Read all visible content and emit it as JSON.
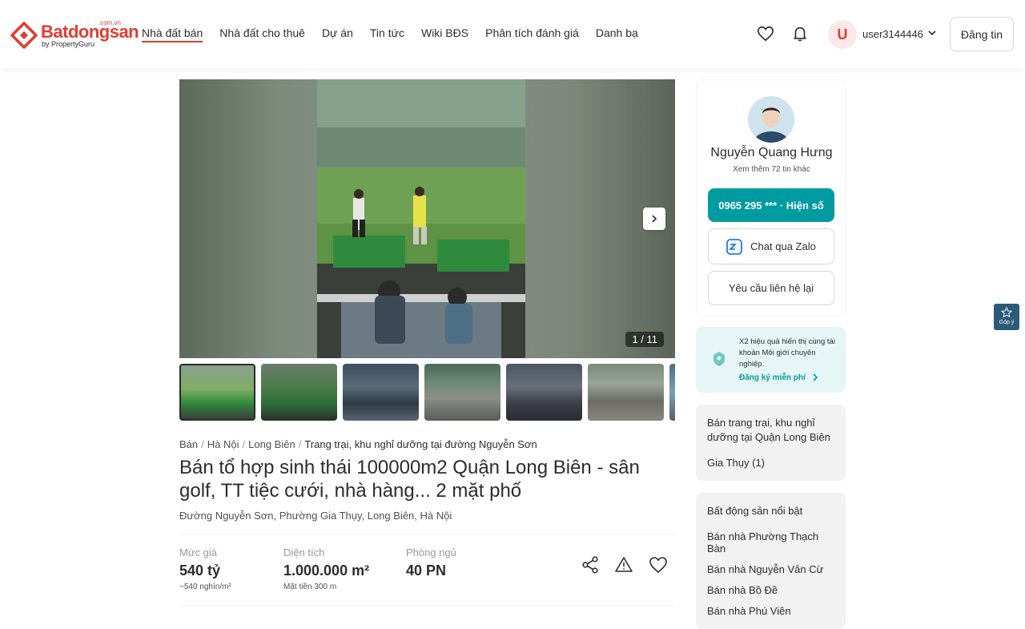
{
  "header": {
    "logo_text": "Batdongsan",
    "logo_comvn": ".com.vn",
    "logo_sub": "by PropertyGuru",
    "nav": [
      "Nhà đất bán",
      "Nhà đất cho thuê",
      "Dự án",
      "Tin tức",
      "Wiki BĐS",
      "Phân tích đánh giá",
      "Danh bạ"
    ],
    "avatar_letter": "U",
    "username": "user3144446",
    "post_label": "Đăng tin"
  },
  "gallery": {
    "counter": "1 / 11",
    "thumb_count": 7
  },
  "listing": {
    "breadcrumb": [
      "Bán",
      "Hà Nội",
      "Long Biên",
      "Trang trại, khu nghỉ dưỡng tại đường Nguyễn Sơn"
    ],
    "title": "Bán tổ hợp sinh thái 100000m2 Quận Long Biên - sân golf, TT tiệc cưới, nhà hàng... 2 mặt phố",
    "address": "Đường Nguyễn Sơn, Phường Gia Thụy, Long Biên, Hà Nội",
    "price_label": "Mức giá",
    "price_value": "540 tỷ",
    "price_sub": "~540 nghìn/m²",
    "area_label": "Diện tích",
    "area_value": "1.000.000 m²",
    "area_sub": "Mặt tiền 300 m",
    "rooms_label": "Phòng ngủ",
    "rooms_value": "40 PN"
  },
  "agent": {
    "name": "Nguyễn Quang Hưng",
    "more": "Xem thêm 72 tin khác",
    "phone": "0965 295 *** · Hiện số",
    "zalo": "Chat qua Zalo",
    "contact": "Yêu cầu liên hệ lại"
  },
  "promo": {
    "text": "X2 hiệu quả hiển thị cùng tài khoản Môi giới chuyên nghiệp.",
    "link": "Đăng ký miễn phí"
  },
  "feedback": "Góp ý",
  "related": {
    "title": "Bán trang trại, khu nghỉ dưỡng tại Quận Long Biên",
    "items": [
      "Gia Thụy (1)"
    ]
  },
  "featured": {
    "title": "Bất động sản nổi bật",
    "items": [
      "Bán nhà Phường Thạch Bàn",
      "Bán nhà Nguyễn Văn Cừ",
      "Bán nhà Bồ Đề",
      "Bán nhà Phú Viên"
    ]
  },
  "colors": {
    "brand": "#e03c31",
    "teal": "#009ba1"
  }
}
